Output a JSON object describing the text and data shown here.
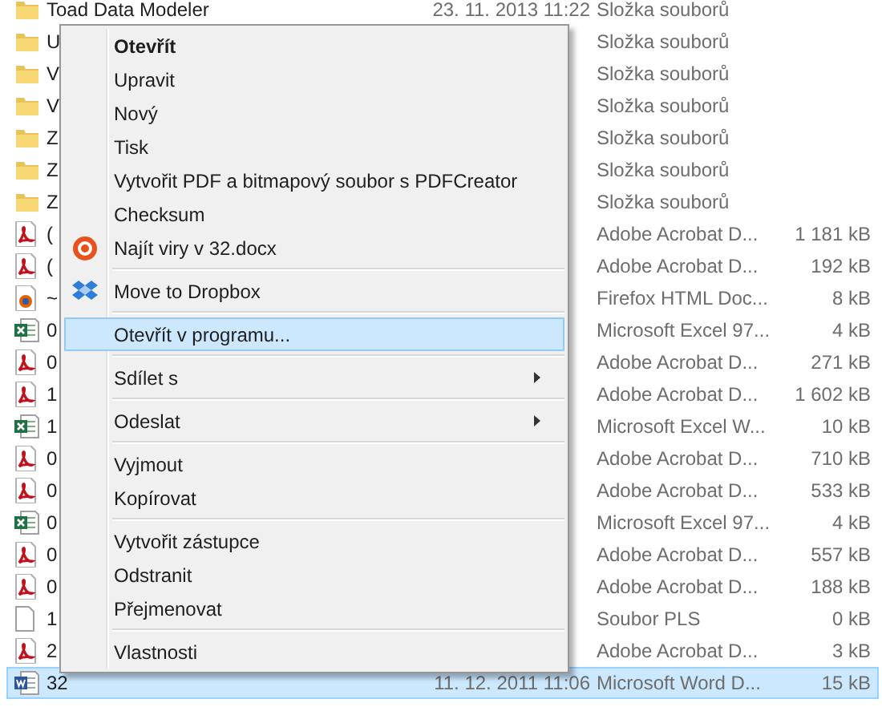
{
  "files": [
    {
      "kind": "folder",
      "name": "Toad Data Modeler",
      "date": "23. 11. 2013 11:22",
      "type": "Složka souborů",
      "selected": false
    },
    {
      "kind": "folder",
      "name": "U",
      "type": "Složka souborů",
      "selected": false
    },
    {
      "kind": "folder",
      "name": "V",
      "type": "Složka souborů",
      "selected": false
    },
    {
      "kind": "folder",
      "name": "V",
      "type": "Složka souborů",
      "selected": false
    },
    {
      "kind": "folder",
      "name": "Z",
      "type": "Složka souborů",
      "selected": false
    },
    {
      "kind": "folder",
      "name": "Z",
      "type": "Složka souborů",
      "selected": false
    },
    {
      "kind": "folder",
      "name": "Z",
      "type": "Složka souborů",
      "selected": false
    },
    {
      "kind": "pdf",
      "name": "(",
      "type": "Adobe Acrobat D...",
      "size": "1 181 kB",
      "selected": false
    },
    {
      "kind": "pdf",
      "name": "(",
      "type": "Adobe Acrobat D...",
      "size": "192 kB",
      "selected": false
    },
    {
      "kind": "html",
      "name": "~",
      "type": "Firefox HTML Doc...",
      "size": "8 kB",
      "selected": false
    },
    {
      "kind": "excel",
      "name": "0",
      "type": "Microsoft Excel 97...",
      "size": "4 kB",
      "selected": false
    },
    {
      "kind": "pdf",
      "name": "0",
      "type": "Adobe Acrobat D...",
      "size": "271 kB",
      "selected": false
    },
    {
      "kind": "pdf",
      "name": "1",
      "type": "Adobe Acrobat D...",
      "size": "1 602 kB",
      "selected": false
    },
    {
      "kind": "excel",
      "name": "1",
      "type": "Microsoft Excel W...",
      "size": "10 kB",
      "selected": false
    },
    {
      "kind": "pdf",
      "name": "0",
      "type": "Adobe Acrobat D...",
      "size": "710 kB",
      "selected": false
    },
    {
      "kind": "pdf",
      "name": "0",
      "type": "Adobe Acrobat D...",
      "size": "533 kB",
      "selected": false
    },
    {
      "kind": "excel",
      "name": "0",
      "type": "Microsoft Excel 97...",
      "size": "4 kB",
      "selected": false
    },
    {
      "kind": "pdf",
      "name": "0",
      "type": "Adobe Acrobat D...",
      "size": "557 kB",
      "selected": false
    },
    {
      "kind": "pdf",
      "name": "0",
      "type": "Adobe Acrobat D...",
      "size": "188 kB",
      "selected": false
    },
    {
      "kind": "blank",
      "name": "1",
      "type": "Soubor PLS",
      "size": "0 kB",
      "selected": false
    },
    {
      "kind": "pdf",
      "name": "2",
      "type": "Adobe Acrobat D...",
      "size": "3 kB",
      "selected": false
    },
    {
      "kind": "word",
      "name": "32",
      "date": "11. 12. 2011 11:06",
      "type": "Microsoft Word D...",
      "size": "15 kB",
      "selected": true
    }
  ],
  "context_menu": {
    "groups": [
      [
        {
          "label": "Otevřít",
          "default": true,
          "selected": false
        },
        {
          "label": "Upravit",
          "default": false,
          "selected": false
        },
        {
          "label": "Nový",
          "default": false,
          "selected": false
        },
        {
          "label": "Tisk",
          "default": false,
          "selected": false
        },
        {
          "label": "Vytvořit PDF a bitmapový soubor s PDFCreator",
          "default": false,
          "selected": false
        },
        {
          "label": "Checksum",
          "default": false,
          "selected": false
        },
        {
          "label": "Najít viry v 32.docx",
          "default": false,
          "selected": false,
          "kind": "antivirus"
        }
      ],
      [
        {
          "label": "Move to Dropbox",
          "default": false,
          "selected": false,
          "kind": "dropbox"
        }
      ],
      [
        {
          "label": "Otevřít v programu...",
          "default": false,
          "selected": true
        }
      ],
      [
        {
          "label": "Sdílet s",
          "default": false,
          "selected": false,
          "submenu": true
        }
      ],
      [
        {
          "label": "Odeslat",
          "default": false,
          "selected": false,
          "submenu": true
        }
      ],
      [
        {
          "label": "Vyjmout",
          "default": false,
          "selected": false
        },
        {
          "label": "Kopírovat",
          "default": false,
          "selected": false
        }
      ],
      [
        {
          "label": "Vytvořit zástupce",
          "default": false,
          "selected": false
        },
        {
          "label": "Odstranit",
          "default": false,
          "selected": false
        },
        {
          "label": "Přejmenovat",
          "default": false,
          "selected": false
        }
      ],
      [
        {
          "label": "Vlastnosti",
          "default": false,
          "selected": false
        }
      ]
    ]
  }
}
